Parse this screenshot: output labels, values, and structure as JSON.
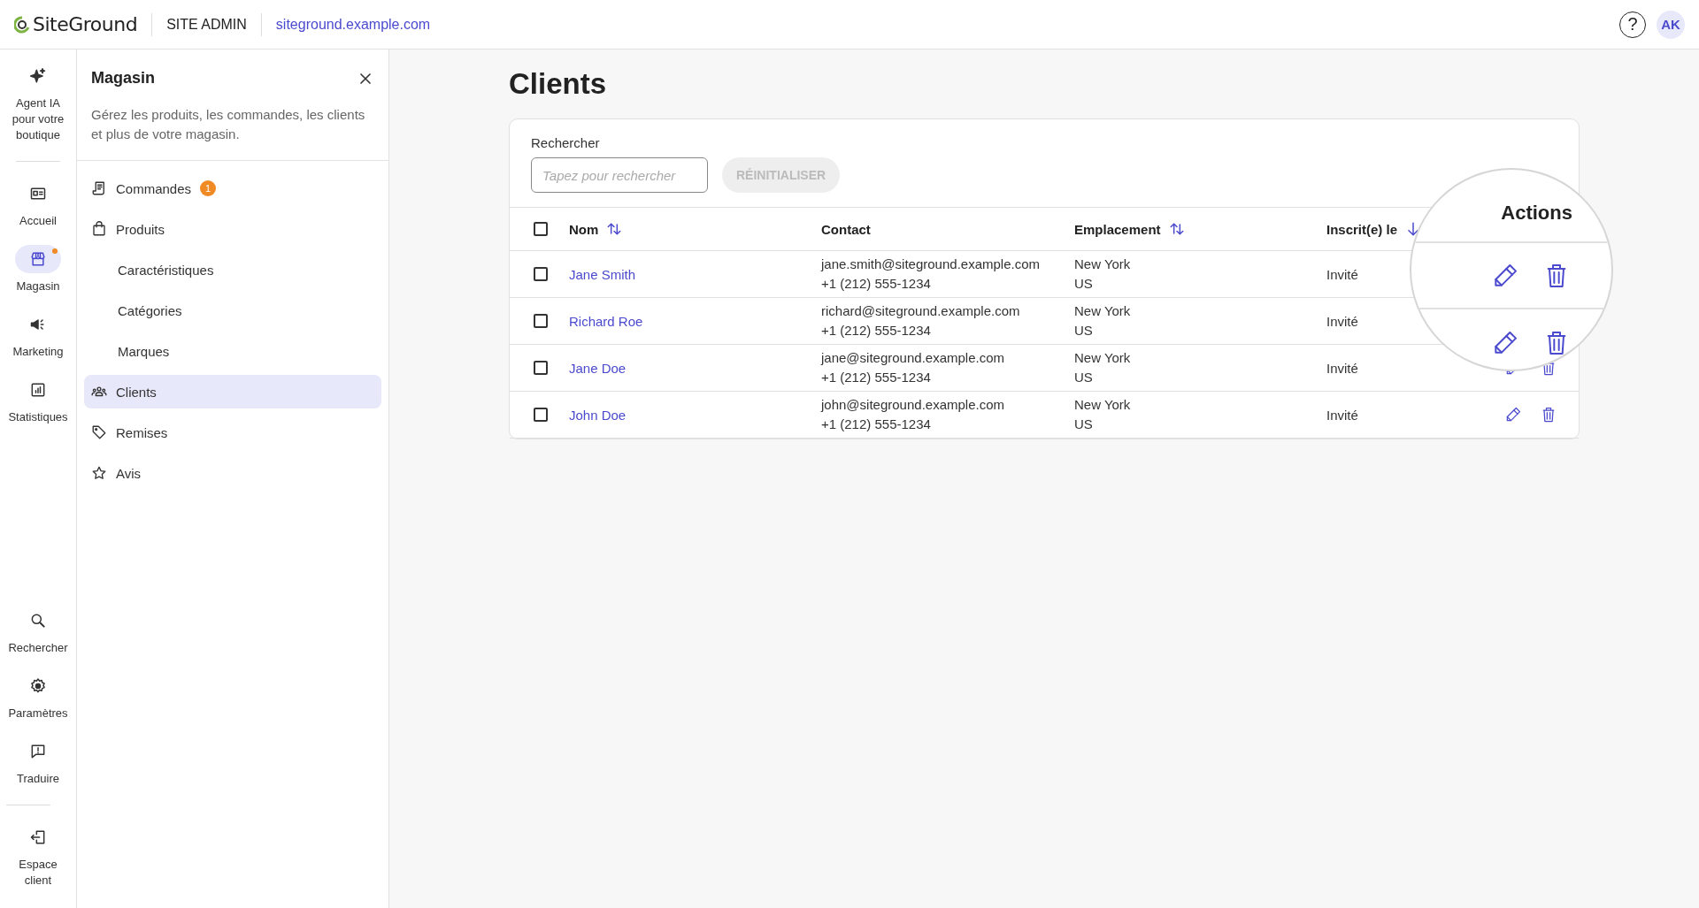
{
  "header": {
    "logo": "SiteGround",
    "section": "SITE ADMIN",
    "domain": "siteground.example.com",
    "help": "?",
    "avatar": "AK"
  },
  "rail": {
    "top": [
      [
        {
          "kind": "sparkle",
          "label": "Agent IA pour votre boutique",
          "selected": false,
          "notification": false
        }
      ],
      [
        {
          "kind": "home",
          "label": "Accueil",
          "selected": false,
          "notification": false
        },
        {
          "kind": "store",
          "label": "Magasin",
          "selected": true,
          "notification": true
        },
        {
          "kind": "megaphone",
          "label": "Marketing",
          "selected": false,
          "notification": false
        },
        {
          "kind": "stats",
          "label": "Statistiques",
          "selected": false,
          "notification": false
        }
      ]
    ],
    "bottom": [
      [
        {
          "kind": "search",
          "label": "Rechercher",
          "selected": false,
          "notification": false
        },
        {
          "kind": "gear",
          "label": "Paramètres",
          "selected": false,
          "notification": false
        },
        {
          "kind": "feedback",
          "label": "Traduire",
          "selected": false,
          "notification": false
        }
      ],
      [
        {
          "kind": "exit",
          "label": "Espace client",
          "selected": false,
          "notification": false
        }
      ]
    ]
  },
  "panel": {
    "title": "Magasin",
    "description": "Gérez les produits, les commandes, les clients et plus de votre magasin.",
    "items": [
      {
        "kind": "receipt",
        "label": "Commandes",
        "badge": "1",
        "selected": false
      },
      {
        "kind": "bag",
        "label": "Produits",
        "selected": false,
        "children": [
          {
            "label": "Caractéristiques",
            "selected": false
          },
          {
            "label": "Catégories",
            "selected": false
          },
          {
            "label": "Marques",
            "selected": false
          }
        ]
      },
      {
        "kind": "people",
        "label": "Clients",
        "selected": true
      },
      {
        "kind": "tag",
        "label": "Remises",
        "selected": false
      },
      {
        "kind": "star",
        "label": "Avis",
        "selected": false
      }
    ]
  },
  "page": {
    "title": "Clients"
  },
  "search": {
    "label": "Rechercher",
    "placeholder": "Tapez pour rechercher",
    "reset": "RÉINITIALISER",
    "reset_disabled": true
  },
  "table": {
    "select_all": false,
    "columns": [
      {
        "label": "Nom",
        "kind": "sortable"
      },
      {
        "label": "Contact",
        "kind": "plain"
      },
      {
        "label": "Emplacement",
        "kind": "sortable"
      },
      {
        "label": "Inscrit(e) le",
        "kind": "sorted_down"
      }
    ],
    "rows": [
      {
        "checked": false,
        "name": "Jane Smith",
        "email": "jane.smith@siteground.example.com",
        "phone": "+1 (212) 555-1234",
        "city": "New York",
        "country": "US",
        "registered": "Invité",
        "actions_visible": false
      },
      {
        "checked": false,
        "name": "Richard Roe",
        "email": "richard@siteground.example.com",
        "phone": "+1 (212) 555-1234",
        "city": "New York",
        "country": "US",
        "registered": "Invité",
        "actions_visible": false
      },
      {
        "checked": false,
        "name": "Jane Doe",
        "email": "jane@siteground.example.com",
        "phone": "+1 (212) 555-1234",
        "city": "New York",
        "country": "US",
        "registered": "Invité",
        "actions_visible": true
      },
      {
        "checked": false,
        "name": "John Doe",
        "email": "john@siteground.example.com",
        "phone": "+1 (212) 555-1234",
        "city": "New York",
        "country": "US",
        "registered": "Invité",
        "actions_visible": true
      }
    ]
  },
  "magnifier": {
    "header": "Actions",
    "rows": [
      {
        "kind": "actions"
      },
      {
        "kind": "actions"
      }
    ]
  }
}
